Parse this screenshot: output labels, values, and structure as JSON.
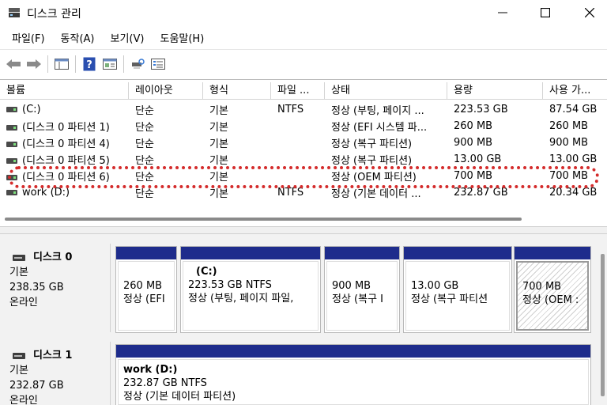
{
  "window": {
    "title": "디스크 관리",
    "icon": "disk-management-icon"
  },
  "menu": [
    "파일(F)",
    "동작(A)",
    "보기(V)",
    "도움말(H)"
  ],
  "toolbar": {
    "icons": [
      "back-arrow-icon",
      "forward-arrow-icon",
      "console-tree-icon",
      "help-icon",
      "properties-icon",
      "rescan-icon",
      "list-view-icon"
    ]
  },
  "volumes": {
    "columns": [
      "볼륨",
      "레이아웃",
      "형식",
      "파일 ...",
      "상태",
      "용량",
      "사용 가..."
    ],
    "rows": [
      [
        "(C:)",
        "단순",
        "기본",
        "NTFS",
        "정상 (부팅, 페이지 ...",
        "223.53 GB",
        "87.54 GB"
      ],
      [
        "(디스크 0 파티션 1)",
        "단순",
        "기본",
        "",
        "정상 (EFI 시스템 파...",
        "260 MB",
        "260 MB"
      ],
      [
        "(디스크 0 파티션 4)",
        "단순",
        "기본",
        "",
        "정상 (복구 파티션)",
        "900 MB",
        "900 MB"
      ],
      [
        "(디스크 0 파티션 5)",
        "단순",
        "기본",
        "",
        "정상 (복구 파티션)",
        "13.00 GB",
        "13.00 GB"
      ],
      [
        "(디스크 0 파티션 6)",
        "단순",
        "기본",
        "",
        "정상 (OEM 파티션)",
        "700 MB",
        "700 MB"
      ],
      [
        "work (D:)",
        "단순",
        "기본",
        "NTFS",
        "정상 (기본 데이터 ...",
        "232.87 GB",
        "20.34 GB"
      ]
    ],
    "highlight_color": "#d42c2c"
  },
  "disks": [
    {
      "name": "디스크 0",
      "type": "기본",
      "size": "238.35 GB",
      "status": "온라인",
      "partitions": [
        {
          "title": "",
          "size": "260 MB",
          "status": "정상 (EFI"
        },
        {
          "title": "(C:)",
          "size": "223.53 GB NTFS",
          "status": "정상 (부팅, 페이지 파일,"
        },
        {
          "title": "",
          "size": "900 MB",
          "status": "정상 (복구 I"
        },
        {
          "title": "",
          "size": "13.00 GB",
          "status": "정상 (복구 파티션"
        },
        {
          "title": "",
          "size": "700 MB",
          "status": "정상 (OEM :"
        }
      ]
    },
    {
      "name": "디스크 1",
      "type": "기본",
      "size": "232.87 GB",
      "status": "온라인",
      "partitions": [
        {
          "title": "work  (D:)",
          "size": "232.87 GB NTFS",
          "status": "정상 (기본 데이터 파티션)"
        }
      ]
    }
  ],
  "colors": {
    "partition_bar": "#1e2c8c"
  }
}
